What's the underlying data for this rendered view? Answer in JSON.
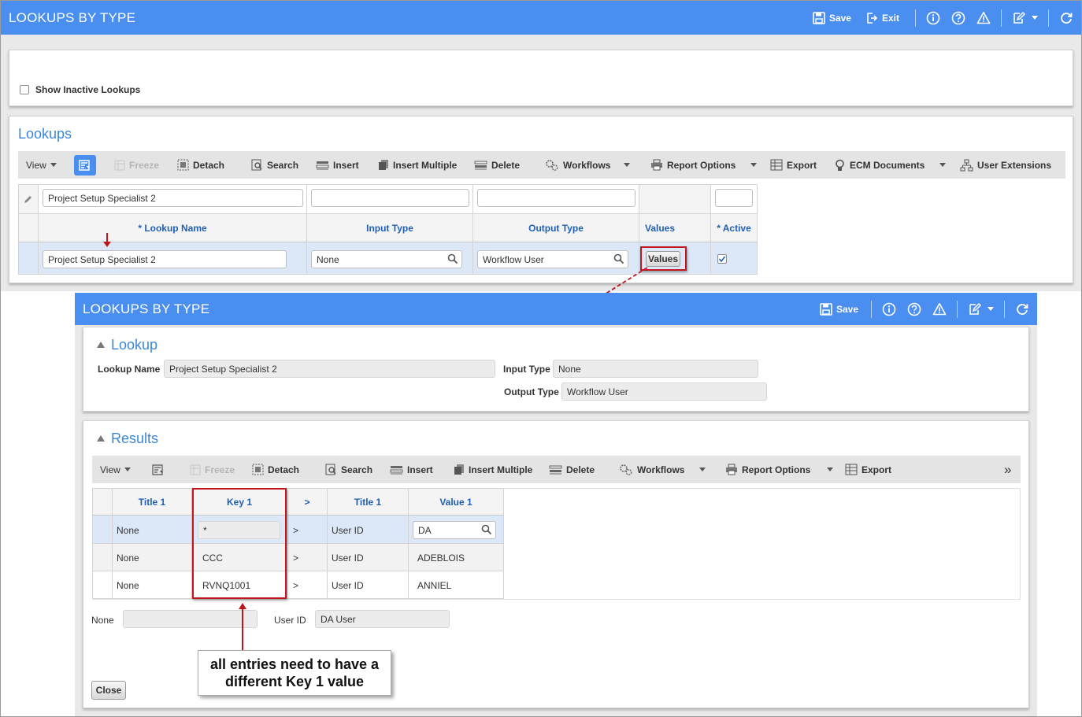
{
  "main_window": {
    "title": "LOOKUPS BY TYPE",
    "save_label": "Save",
    "exit_label": "Exit",
    "icons": [
      "info-icon",
      "help-icon",
      "warning-icon",
      "edit-icon",
      "refresh-icon"
    ]
  },
  "filter": {
    "show_inactive_label": "Show Inactive Lookups",
    "show_inactive_checked": false
  },
  "lookups": {
    "title": "Lookups",
    "toolbar": {
      "view": "View",
      "freeze": "Freeze",
      "detach": "Detach",
      "search": "Search",
      "insert": "Insert",
      "insert_multiple": "Insert Multiple",
      "delete": "Delete",
      "workflows": "Workflows",
      "report_options": "Report Options",
      "export": "Export",
      "ecm_documents": "ECM Documents",
      "user_extensions": "User Extensions"
    },
    "filter_row": {
      "lookup_name": "Project Setup Specialist 2",
      "input_type": "",
      "output_type": "",
      "active": ""
    },
    "columns": [
      "* Lookup Name",
      "Input Type",
      "Output Type",
      "Values",
      "* Active"
    ],
    "row": {
      "lookup_name": "Project Setup Specialist 2",
      "input_type": "None",
      "output_type": "Workflow User",
      "values_button": "Values",
      "active": true
    }
  },
  "dialog": {
    "title": "LOOKUPS BY TYPE",
    "save_label": "Save",
    "lookup_section": {
      "title": "Lookup",
      "lookup_name_label": "Lookup Name",
      "lookup_name_value": "Project Setup Specialist 2",
      "input_type_label": "Input Type",
      "input_type_value": "None",
      "output_type_label": "Output Type",
      "output_type_value": "Workflow User"
    },
    "results_section": {
      "title": "Results",
      "toolbar": {
        "view": "View",
        "freeze": "Freeze",
        "detach": "Detach",
        "search": "Search",
        "insert": "Insert",
        "insert_multiple": "Insert Multiple",
        "delete": "Delete",
        "workflows": "Workflows",
        "report_options": "Report Options",
        "export": "Export",
        "more": "»"
      },
      "columns": [
        "Title 1",
        "Key 1",
        ">",
        "Title 1",
        "Value 1"
      ],
      "rows": [
        {
          "title1": "None",
          "key1": "*",
          "sep": ">",
          "title1b": "User ID",
          "value1": "DA"
        },
        {
          "title1": "None",
          "key1": "CCC",
          "sep": ">",
          "title1b": "User ID",
          "value1": "ADEBLOIS"
        },
        {
          "title1": "None",
          "key1": "RVNQ1001",
          "sep": ">",
          "title1b": "User ID",
          "value1": "ANNIEL"
        }
      ],
      "detail": {
        "none_label": "None",
        "none_value": "",
        "user_id_label": "User ID",
        "user_id_value": "DA User"
      },
      "close_label": "Close"
    }
  },
  "annotation": {
    "callout_line1": "all entries need to have a",
    "callout_line2": "different Key 1 value"
  },
  "colors": {
    "titlebar": "#4a8ef0",
    "header_text": "#1f5fb5",
    "section_title": "#3a87d9",
    "annotation_red": "#c0161c",
    "selected_row": "#dce8f8"
  }
}
